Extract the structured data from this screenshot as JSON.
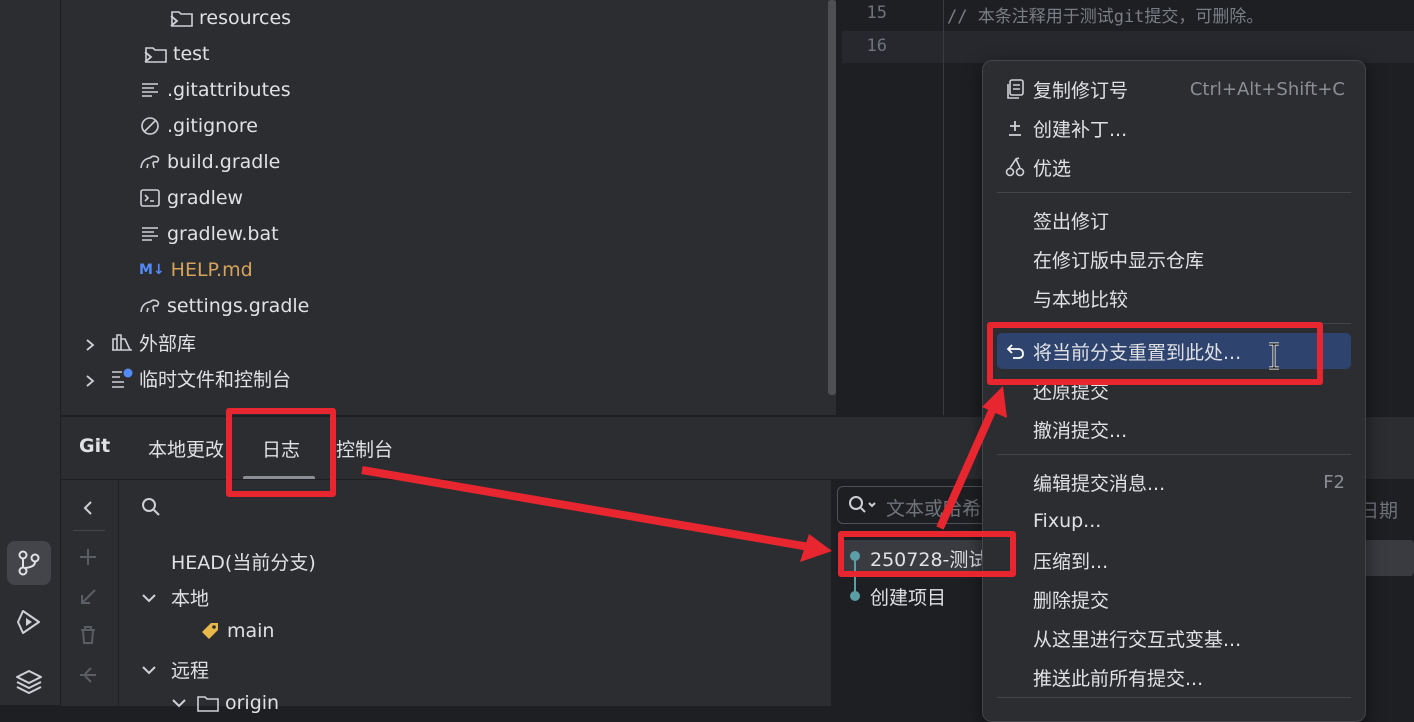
{
  "tree": {
    "items": [
      {
        "label": "resources",
        "icon": "folder-icon",
        "chevron": true,
        "color": "#dfe1e5"
      },
      {
        "label": "test",
        "icon": "folder-icon",
        "chevron": true,
        "color": "#dfe1e5"
      },
      {
        "label": ".gitattributes",
        "icon": "text-file-icon",
        "chevron": false,
        "color": "#dfe1e5"
      },
      {
        "label": ".gitignore",
        "icon": "ignore-file-icon",
        "chevron": false,
        "color": "#dfe1e5"
      },
      {
        "label": "build.gradle",
        "icon": "gradle-icon",
        "chevron": false,
        "color": "#dfe1e5"
      },
      {
        "label": "gradlew",
        "icon": "terminal-file-icon",
        "chevron": false,
        "color": "#dfe1e5"
      },
      {
        "label": "gradlew.bat",
        "icon": "text-file-icon",
        "chevron": false,
        "color": "#dfe1e5"
      },
      {
        "label": "HELP.md",
        "icon": "markdown-icon",
        "chevron": false,
        "color": "#d6a35c"
      },
      {
        "label": "settings.gradle",
        "icon": "gradle-icon",
        "chevron": false,
        "color": "#dfe1e5"
      },
      {
        "label": "外部库",
        "icon": "library-icon",
        "chevron": true,
        "color": "#dfe1e5"
      },
      {
        "label": "临时文件和控制台",
        "icon": "scratch-icon",
        "chevron": true,
        "color": "#dfe1e5"
      }
    ],
    "markdown_badge": "M↓"
  },
  "editor": {
    "lines": [
      {
        "no": "15",
        "text": "// 本条注释用于测试git提交，可删除。"
      },
      {
        "no": "16",
        "text": ""
      }
    ]
  },
  "git": {
    "title": "Git",
    "tabs": [
      "本地更改",
      "日志",
      "控制台"
    ],
    "branches": {
      "head": "HEAD(当前分支)",
      "local": "本地",
      "main": "main",
      "remote": "远程",
      "origin": "origin"
    },
    "commits": {
      "search_placeholder": "文本或哈希",
      "date_header": "日期",
      "rows": [
        "250728-测试",
        "创建项目"
      ]
    }
  },
  "menu": {
    "items": [
      {
        "label": "复制修订号",
        "shortcut": "Ctrl+Alt+Shift+C",
        "icon": "copy-icon"
      },
      {
        "label": "创建补丁...",
        "shortcut": "",
        "icon": "plus-minus-icon"
      },
      {
        "label": "优选",
        "shortcut": "",
        "icon": "cherry-pick-icon"
      },
      {
        "label": "签出修订",
        "shortcut": "",
        "icon": ""
      },
      {
        "label": "在修订版中显示仓库",
        "shortcut": "",
        "icon": ""
      },
      {
        "label": "与本地比较",
        "shortcut": "",
        "icon": ""
      },
      {
        "label": "将当前分支重置到此处...",
        "shortcut": "",
        "icon": "undo-icon"
      },
      {
        "label": "还原提交",
        "shortcut": "",
        "icon": ""
      },
      {
        "label": "撤消提交...",
        "shortcut": "",
        "icon": ""
      },
      {
        "label": "编辑提交消息...",
        "shortcut": "F2",
        "icon": ""
      },
      {
        "label": "Fixup...",
        "shortcut": "",
        "icon": ""
      },
      {
        "label": "压缩到...",
        "shortcut": "",
        "icon": ""
      },
      {
        "label": "删除提交",
        "shortcut": "",
        "icon": ""
      },
      {
        "label": "从这里进行交互式变基...",
        "shortcut": "",
        "icon": ""
      },
      {
        "label": "推送此前所有提交...",
        "shortcut": "",
        "icon": ""
      }
    ]
  },
  "colors": {
    "highlight": "#2e436e",
    "annotation": "#e8262f",
    "accent_file": "#d6a35c"
  }
}
